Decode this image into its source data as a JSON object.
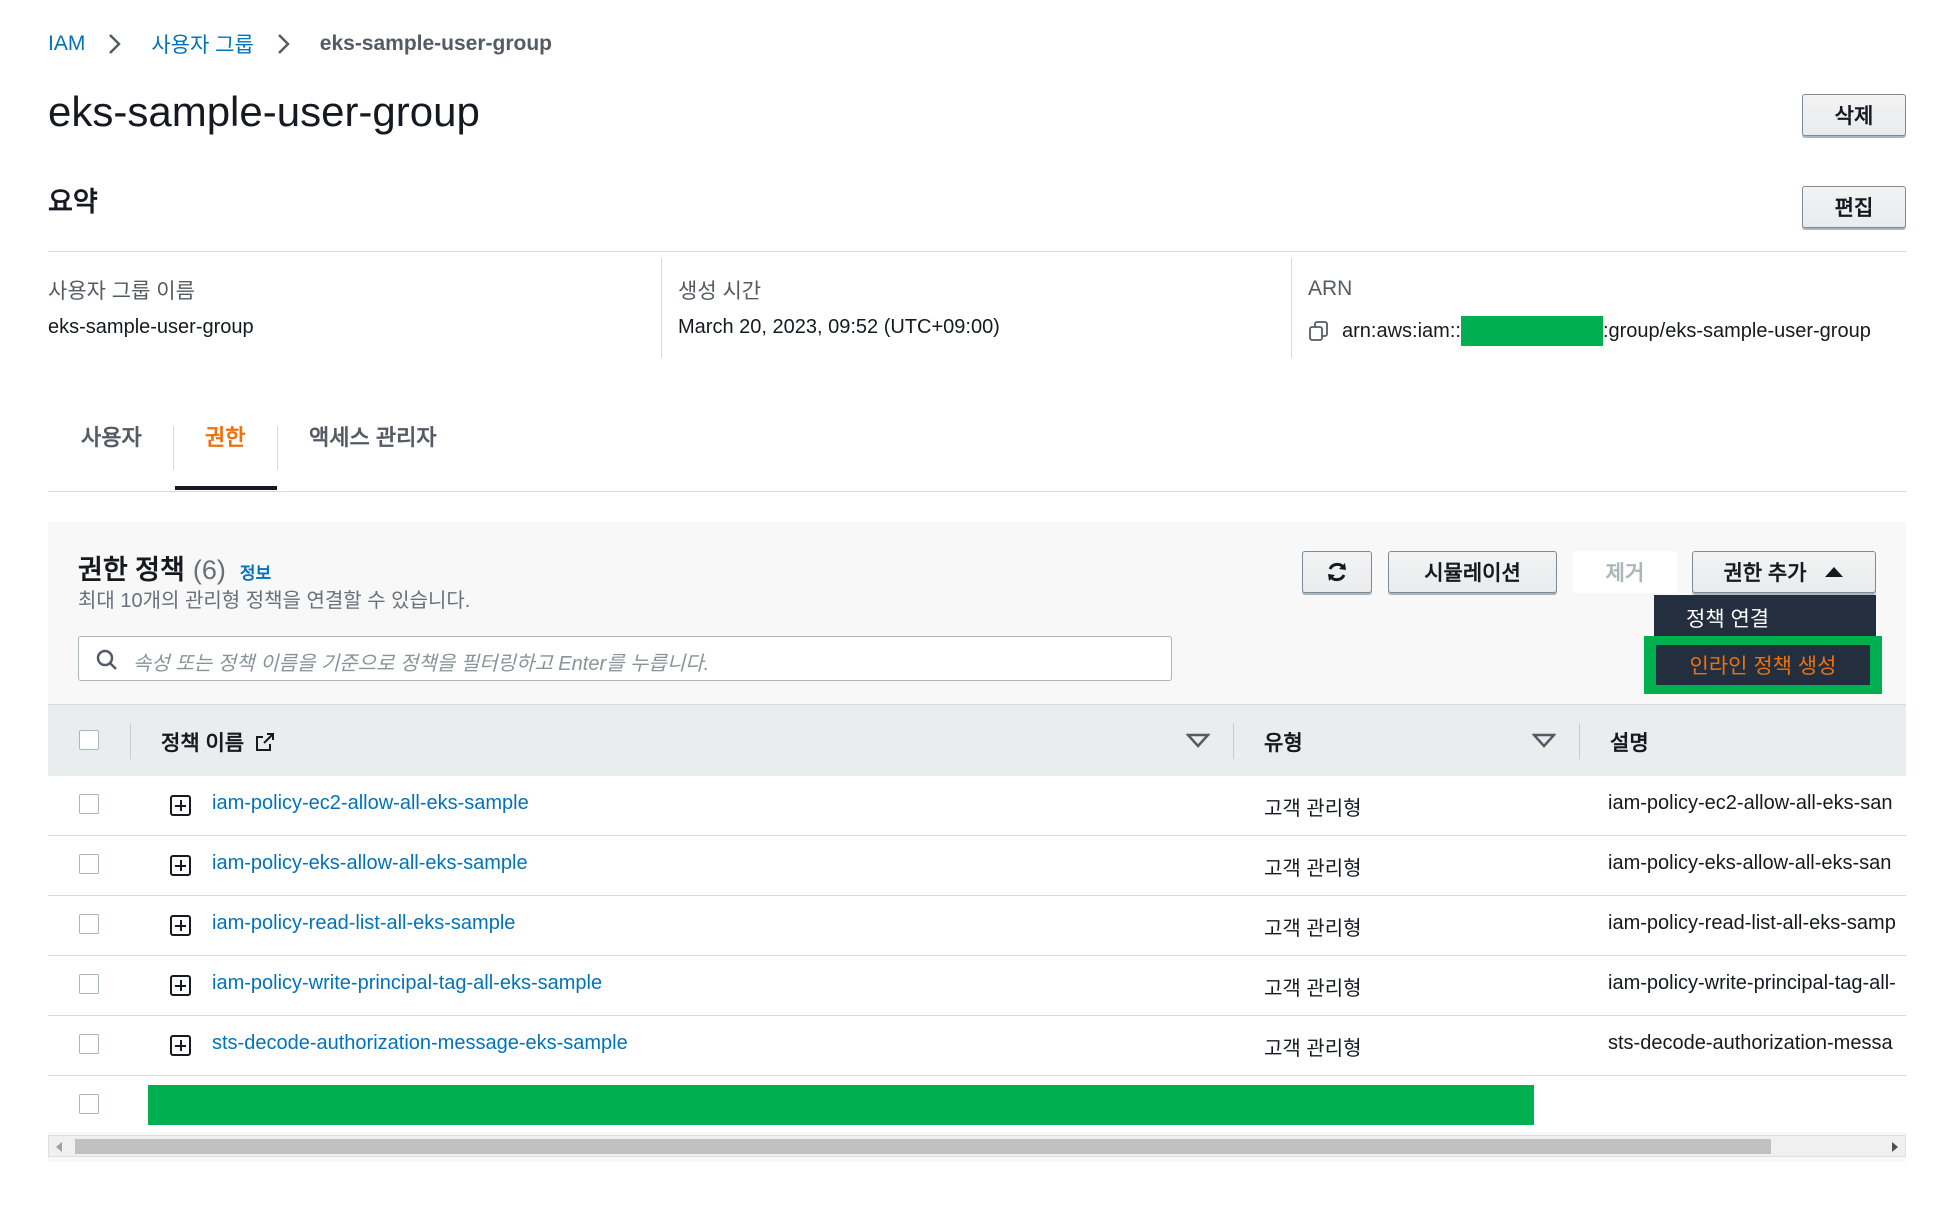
{
  "breadcrumb": {
    "root": "IAM",
    "parent": "사용자 그룹",
    "current": "eks-sample-user-group"
  },
  "page_title": "eks-sample-user-group",
  "buttons": {
    "delete": "삭제",
    "edit": "편집"
  },
  "summary": {
    "title": "요약",
    "group_name_label": "사용자 그룹 이름",
    "group_name_value": "eks-sample-user-group",
    "created_label": "생성 시간",
    "created_value": "March 20, 2023, 09:52 (UTC+09:00)",
    "arn_label": "ARN",
    "arn_prefix": "arn:aws:iam::",
    "arn_suffix": ":group/eks-sample-user-group"
  },
  "tabs": [
    {
      "label": "사용자",
      "active": false
    },
    {
      "label": "권한",
      "active": true
    },
    {
      "label": "액세스 관리자",
      "active": false
    }
  ],
  "policies": {
    "title": "권한 정책",
    "count": "(6)",
    "info": "정보",
    "subtitle": "최대 10개의 관리형 정책을 연결할 수 있습니다.",
    "search_placeholder": "속성 또는 정책 이름을 기준으로 정책을 필터링하고 Enter를 누릅니다.",
    "simulate_button": "시뮬레이션",
    "remove_button": "제거",
    "add_button": "권한 추가",
    "dropdown": {
      "attach": "정책 연결",
      "inline": "인라인 정책 생성"
    },
    "columns": {
      "name": "정책 이름",
      "type": "유형",
      "description": "설명"
    },
    "rows": [
      {
        "name": "iam-policy-ec2-allow-all-eks-sample",
        "type": "고객 관리형",
        "description": "iam-policy-ec2-allow-all-eks-san"
      },
      {
        "name": "iam-policy-eks-allow-all-eks-sample",
        "type": "고객 관리형",
        "description": "iam-policy-eks-allow-all-eks-san"
      },
      {
        "name": "iam-policy-read-list-all-eks-sample",
        "type": "고객 관리형",
        "description": "iam-policy-read-list-all-eks-samp"
      },
      {
        "name": "iam-policy-write-principal-tag-all-eks-sample",
        "type": "고객 관리형",
        "description": "iam-policy-write-principal-tag-all-"
      },
      {
        "name": "sts-decode-authorization-message-eks-sample",
        "type": "고객 관리형",
        "description": "sts-decode-authorization-messa"
      }
    ]
  },
  "colors": {
    "link": "#0073bb",
    "accent": "#ec7211",
    "redaction": "#00b050",
    "dropdown_bg": "#232f3e"
  }
}
